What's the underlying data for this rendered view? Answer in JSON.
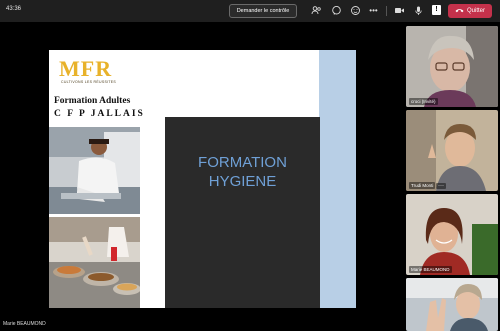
{
  "meeting": {
    "timer": "43:36",
    "request_control_label": "Demander le contrôle",
    "quit_label": "Quitter",
    "toolbar_icons": [
      "people-icon",
      "chat-icon",
      "reactions-icon",
      "more-icon",
      "camera-icon",
      "mic-icon",
      "share-icon"
    ]
  },
  "slide": {
    "logo_text": "MFR",
    "logo_tagline": "CULTIVONS LES RÉUSSITES",
    "line1": "Formation Adultes",
    "line2": "C F P  JALLAIS",
    "title_line1": "FORMATION",
    "title_line2": "HYGIENE"
  },
  "participants": [
    {
      "name": "croci (Invité)"
    },
    {
      "name": "Trudi Monti"
    },
    {
      "name": "Marie BEAUMOND"
    },
    {
      "name": ""
    }
  ],
  "presenter_name": "Marie BEAUMOND",
  "colors": {
    "topbar_bg": "#1f1f1f",
    "quit_red": "#c4314b",
    "slide_blue_band": "#b8cfe6",
    "slide_title_blue": "#6fa0d6",
    "logo_gold": "#e8b22a"
  }
}
